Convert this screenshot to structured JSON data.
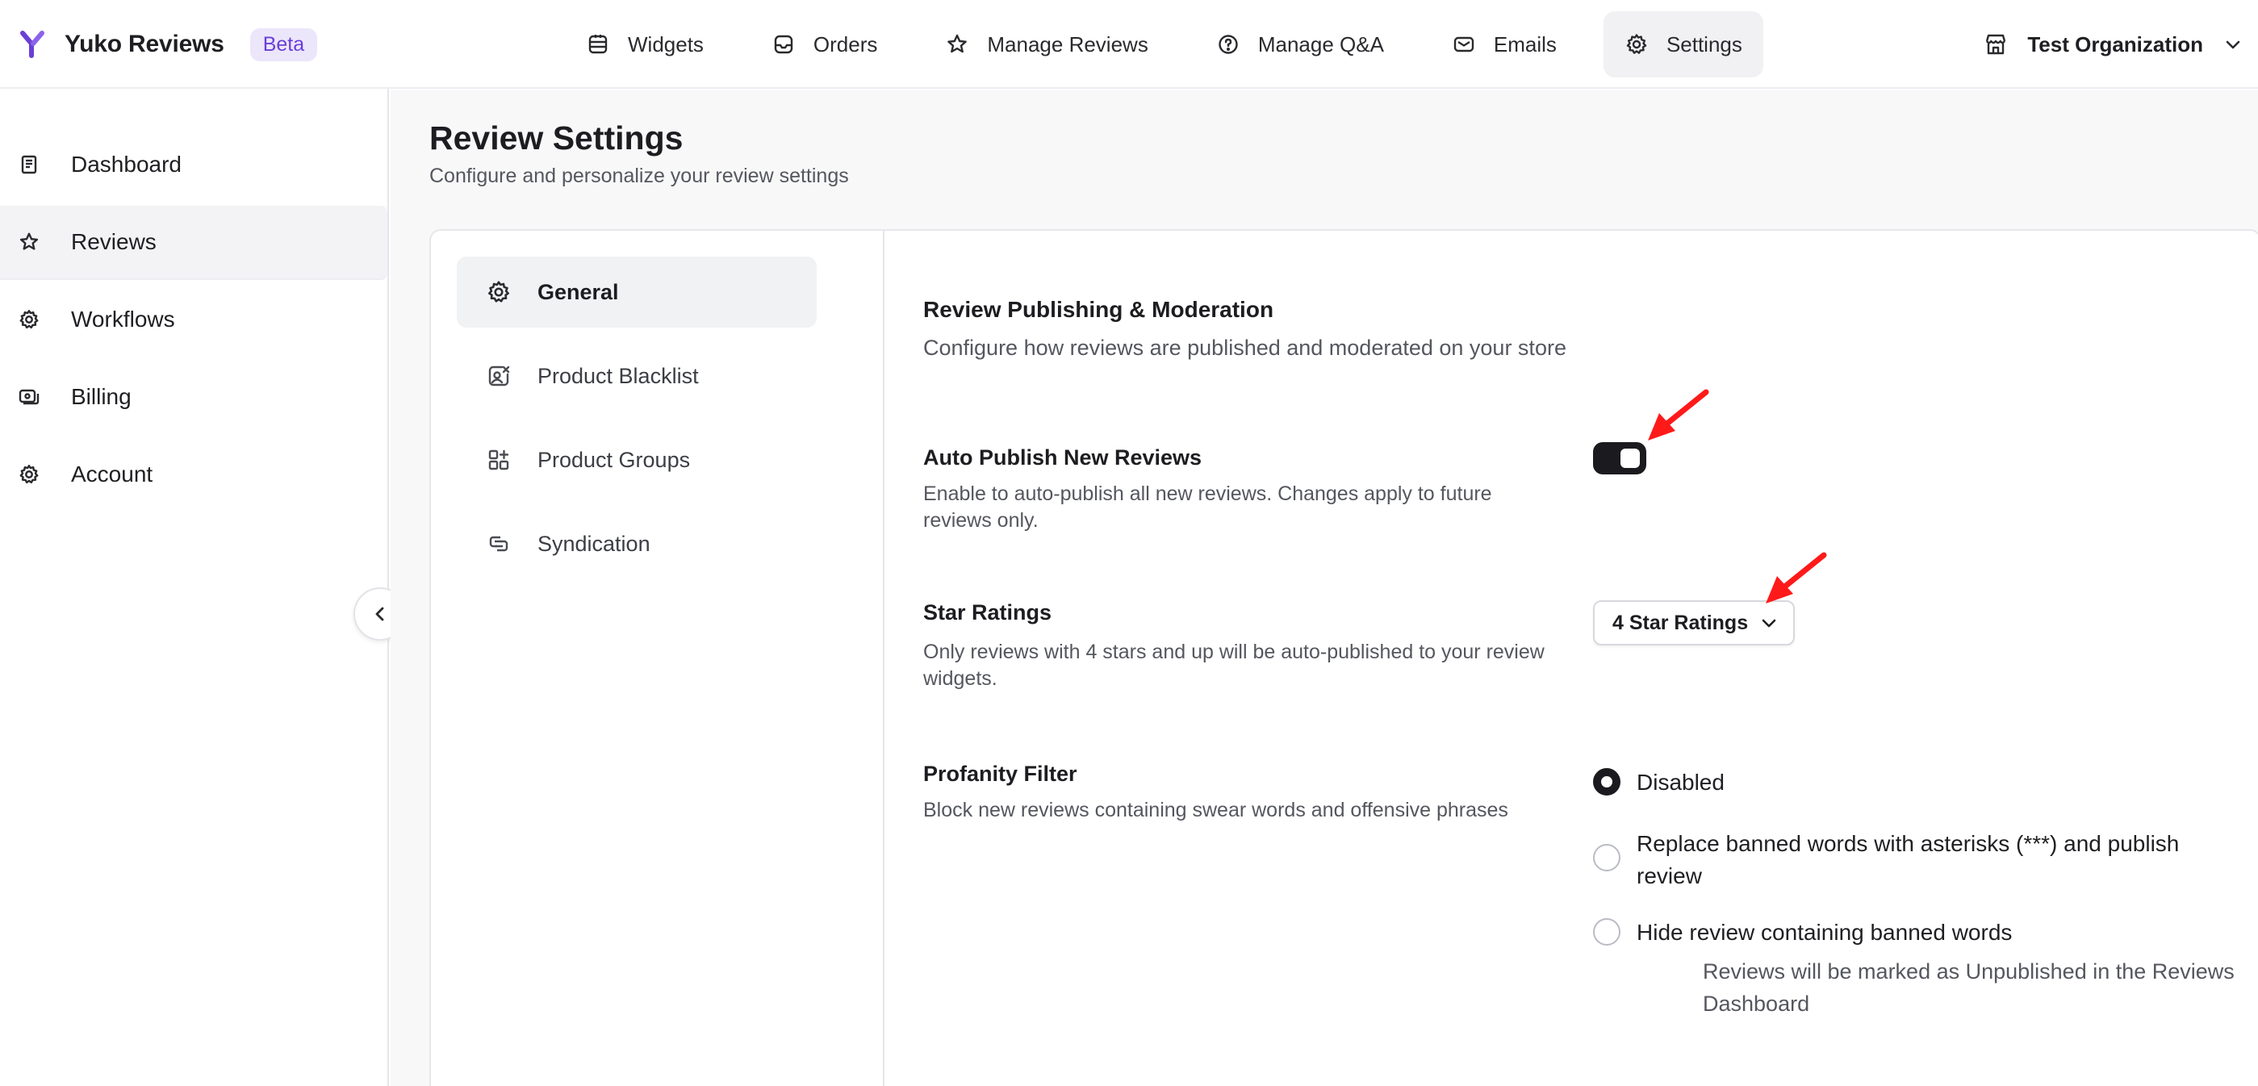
{
  "app": {
    "name": "Yuko Reviews",
    "badge": "Beta"
  },
  "topnav": [
    {
      "label": "Widgets",
      "icon": "widgets-icon"
    },
    {
      "label": "Orders",
      "icon": "inbox-icon"
    },
    {
      "label": "Manage Reviews",
      "icon": "star-icon"
    },
    {
      "label": "Manage Q&A",
      "icon": "question-icon"
    },
    {
      "label": "Emails",
      "icon": "mail-icon"
    },
    {
      "label": "Settings",
      "icon": "gear-icon",
      "active": true
    }
  ],
  "org": {
    "label": "Test Organization",
    "icon": "store-icon"
  },
  "sidebar": {
    "items": [
      {
        "label": "Dashboard",
        "icon": "book-icon"
      },
      {
        "label": "Reviews",
        "icon": "star-icon",
        "active": true
      },
      {
        "label": "Workflows",
        "icon": "cog-icon"
      },
      {
        "label": "Billing",
        "icon": "billing-icon"
      },
      {
        "label": "Account",
        "icon": "gear-icon"
      }
    ]
  },
  "page": {
    "title": "Review Settings",
    "subtitle": "Configure and personalize your review settings"
  },
  "settings_nav": [
    {
      "label": "General",
      "icon": "gear-icon",
      "active": true
    },
    {
      "label": "Product Blacklist",
      "icon": "blacklist-icon"
    },
    {
      "label": "Product Groups",
      "icon": "groups-icon"
    },
    {
      "label": "Syndication",
      "icon": "syndication-icon"
    }
  ],
  "section": {
    "title": "Review Publishing & Moderation",
    "subtitle": "Configure how reviews are published and moderated on your store"
  },
  "auto_publish": {
    "title": "Auto Publish New Reviews",
    "description": "Enable to auto-publish all new reviews. Changes apply to future reviews only.",
    "enabled": true
  },
  "star_ratings": {
    "title": "Star Ratings",
    "description": "Only reviews with 4 stars and up will be auto-published to your review widgets.",
    "selected": "4 Star Ratings"
  },
  "profanity": {
    "title": "Profanity Filter",
    "description": "Block new reviews containing swear words and offensive phrases",
    "options": [
      {
        "label": "Disabled",
        "checked": true
      },
      {
        "label": "Replace banned words with asterisks (***) and publish review",
        "checked": false
      },
      {
        "label": "Hide review containing banned words",
        "checked": false,
        "help": "Reviews will be marked as Unpublished in the Reviews Dashboard"
      }
    ]
  },
  "colors": {
    "accent": "#6a3fd6",
    "badge_bg": "#ece6fb",
    "toggle_on": "#1b1b1f",
    "annotation_arrow": "#ff1a1a"
  }
}
